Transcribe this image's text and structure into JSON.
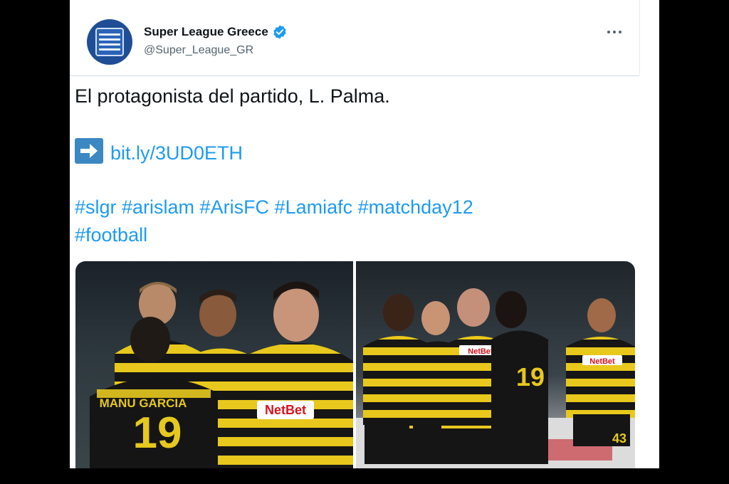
{
  "tweet": {
    "author": {
      "display_name": "Super League Greece",
      "handle": "@Super_League_GR",
      "verified": true,
      "avatar_icon": "super-league-logo-icon"
    },
    "more_icon": "more-horizontal-icon",
    "text_line1": "El protagonista del partido, L. Palma.",
    "link_arrow_icon": "right-arrow-emoji-icon",
    "link": "bit.ly/3UD0ETH",
    "hashtags_line1": "#slgr #arislam #ArisFC #Lamiafc #matchday12",
    "hashtags_line2": "#football",
    "media": {
      "left_photo": {
        "jersey_name": "MANU GARCIA",
        "jersey_number": "19",
        "sponsor": "NetBet"
      },
      "right_photo": {
        "sponsor": "NetBet",
        "sponsor_right": "NetBet",
        "jersey_number": "19",
        "jersey_number_right": "43"
      }
    }
  },
  "colors": {
    "link": "#1d9bf0",
    "text": "#0f1419",
    "secondary": "#536471",
    "verified": "#1d9bf0",
    "jersey_yellow": "#f2d21a",
    "jersey_black": "#161616"
  }
}
